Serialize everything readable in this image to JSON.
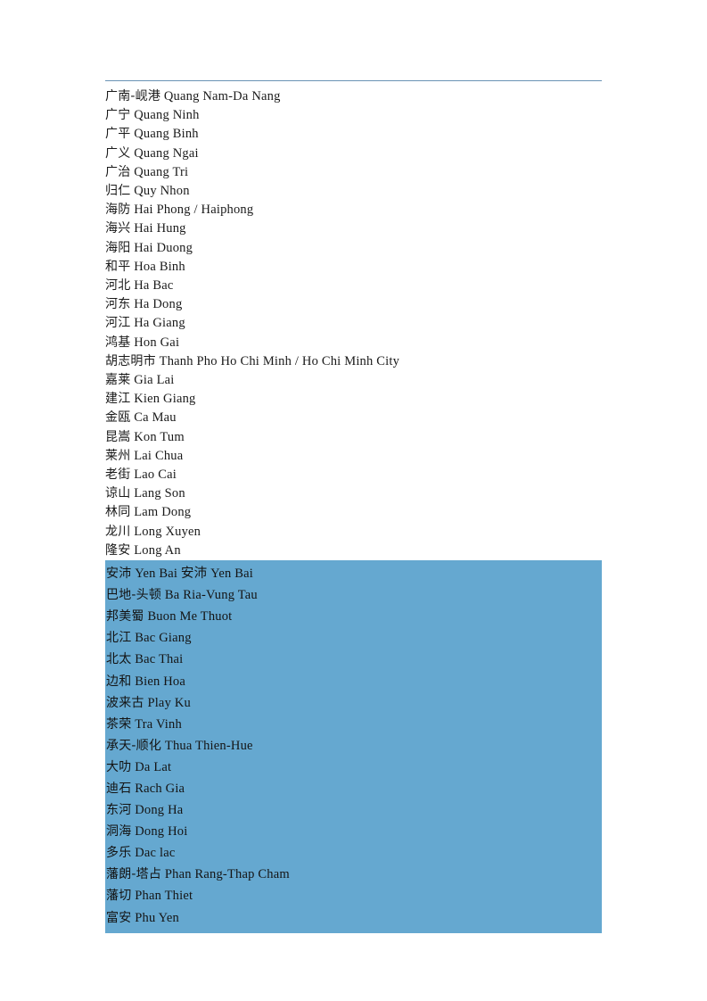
{
  "document": {
    "type": "place-name-glossary",
    "language_pair": "Chinese - Vietnamese romanization",
    "header_rule_color": "#6a93b5",
    "selection_color": "#65a8d0",
    "text_color": "#1a1a1a"
  },
  "unselected_entries": [
    {
      "cn": "广南-岘港",
      "latin": "Quang Nam-Da Nang"
    },
    {
      "cn": "广宁",
      "latin": "Quang Ninh"
    },
    {
      "cn": "广平",
      "latin": "Quang Binh"
    },
    {
      "cn": "广义",
      "latin": "Quang Ngai"
    },
    {
      "cn": "广治",
      "latin": "Quang Tri"
    },
    {
      "cn": "归仁",
      "latin": "Quy Nhon"
    },
    {
      "cn": "海防",
      "latin": "Hai Phong / Haiphong"
    },
    {
      "cn": "海兴",
      "latin": "Hai Hung"
    },
    {
      "cn": "海阳",
      "latin": "Hai Duong"
    },
    {
      "cn": "和平",
      "latin": "Hoa Binh"
    },
    {
      "cn": "河北",
      "latin": "Ha Bac"
    },
    {
      "cn": "河东",
      "latin": "Ha Dong"
    },
    {
      "cn": "河江",
      "latin": "Ha Giang"
    },
    {
      "cn": "鸿基",
      "latin": "Hon Gai"
    },
    {
      "cn": "胡志明市",
      "latin": "Thanh Pho Ho Chi Minh / Ho Chi Minh City"
    },
    {
      "cn": "嘉莱",
      "latin": "Gia Lai"
    },
    {
      "cn": "建江",
      "latin": "Kien Giang"
    },
    {
      "cn": "金瓯",
      "latin": "Ca Mau"
    },
    {
      "cn": "昆嵩",
      "latin": "Kon Tum"
    },
    {
      "cn": "莱州",
      "latin": "Lai Chua"
    },
    {
      "cn": "老街",
      "latin": "Lao Cai"
    },
    {
      "cn": "谅山",
      "latin": "Lang Son"
    },
    {
      "cn": "林同",
      "latin": "Lam Dong"
    },
    {
      "cn": "龙川",
      "latin": "Long Xuyen"
    },
    {
      "cn": "隆安",
      "latin": "Long An"
    }
  ],
  "selected_entries": [
    {
      "cn": "安沛",
      "latin": "Yen Bai 安沛 Yen Bai"
    },
    {
      "cn": "巴地-头顿",
      "latin": "Ba Ria-Vung Tau"
    },
    {
      "cn": "邦美蜀",
      "latin": "Buon Me Thuot"
    },
    {
      "cn": "北江",
      "latin": "Bac Giang"
    },
    {
      "cn": "北太",
      "latin": "Bac Thai"
    },
    {
      "cn": "边和",
      "latin": "Bien Hoa"
    },
    {
      "cn": "波来古",
      "latin": "Play Ku"
    },
    {
      "cn": "茶荣",
      "latin": "Tra Vinh"
    },
    {
      "cn": "承天-顺化",
      "latin": "Thua Thien-Hue"
    },
    {
      "cn": "大叻",
      "latin": "Da Lat"
    },
    {
      "cn": "迪石",
      "latin": "Rach Gia"
    },
    {
      "cn": "东河",
      "latin": "Dong Ha"
    },
    {
      "cn": "洞海",
      "latin": "Dong Hoi"
    },
    {
      "cn": "多乐",
      "latin": "Dac lac"
    },
    {
      "cn": "藩朗-塔占",
      "latin": "Phan Rang-Thap Cham"
    },
    {
      "cn": "藩切",
      "latin": "Phan Thiet"
    },
    {
      "cn": "富安",
      "latin": "Phu Yen"
    }
  ]
}
